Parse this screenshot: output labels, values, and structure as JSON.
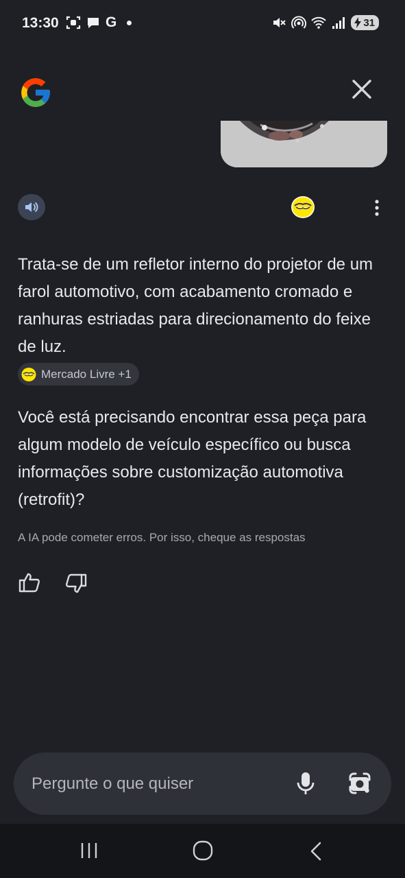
{
  "status_bar": {
    "time": "13:30",
    "left_icons": [
      "screenshot-icon",
      "chat-bubble-icon"
    ],
    "g_label": "G",
    "right_icons": [
      "mute-icon",
      "hotspot-icon",
      "wifi-icon",
      "signal-icon"
    ],
    "battery_level": "31"
  },
  "header": {
    "logo_icon": "google-g-icon",
    "close_icon": "close-icon"
  },
  "response": {
    "paragraph_1": "Trata-se de um refletor interno do projetor de um farol automotivo, com acabamento cromado e ranhuras estriadas para direcionamento do feixe de luz.",
    "source_chip": "Mercado Livre +1",
    "paragraph_2": "Você está precisando encontrar essa peça para algum modelo de veículo específico ou busca informações sobre customização automotiva (retrofit)?",
    "disclaimer": "A IA pode cometer erros. Por isso, cheque as respostas"
  },
  "input": {
    "placeholder": "Pergunte o que quiser"
  },
  "colors": {
    "background": "#1f2025",
    "input_bg": "#2e3138",
    "nav_bg": "#141519",
    "speaker_bg": "#3c4454",
    "mercado_livre_yellow": "#ffe600"
  }
}
